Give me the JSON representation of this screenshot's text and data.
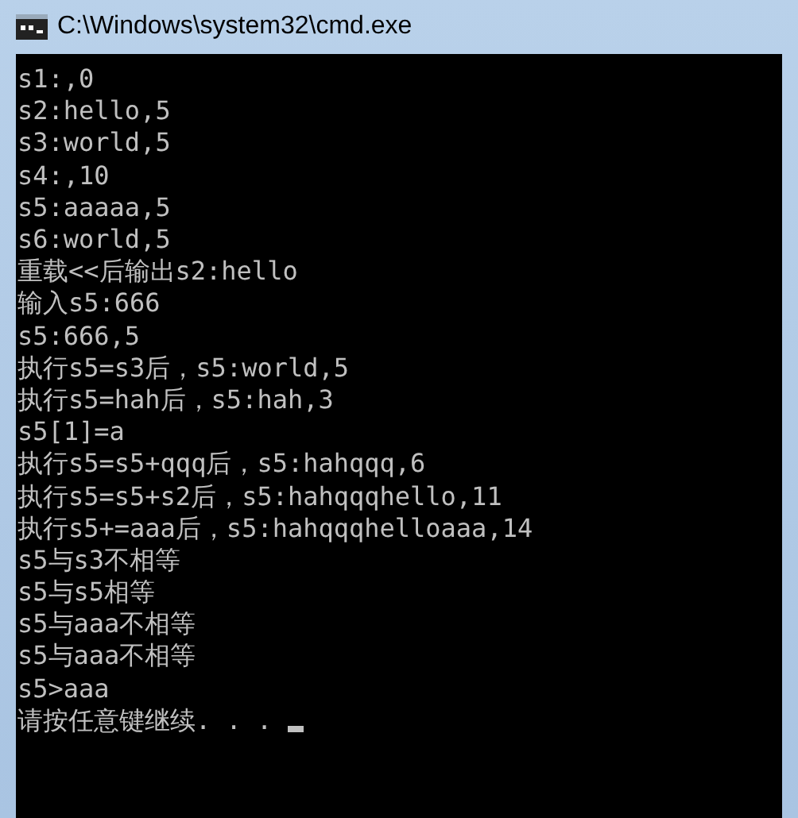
{
  "window": {
    "title": "C:\\Windows\\system32\\cmd.exe"
  },
  "console": {
    "lines": [
      "s1:,0",
      "s2:hello,5",
      "s3:world,5",
      "s4:,10",
      "s5:aaaaa,5",
      "s6:world,5",
      "重载<<后输出s2:hello",
      "输入s5:666",
      "s5:666,5",
      "执行s5=s3后，s5:world,5",
      "执行s5=hah后，s5:hah,3",
      "s5[1]=a",
      "执行s5=s5+qqq后，s5:hahqqq,6",
      "执行s5=s5+s2后，s5:hahqqqhello,11",
      "执行s5+=aaa后，s5:hahqqqhelloaaa,14",
      "s5与s3不相等",
      "s5与s5相等",
      "s5与aaa不相等",
      "s5与aaa不相等",
      "s5>aaa",
      "请按任意键继续. . ."
    ]
  }
}
